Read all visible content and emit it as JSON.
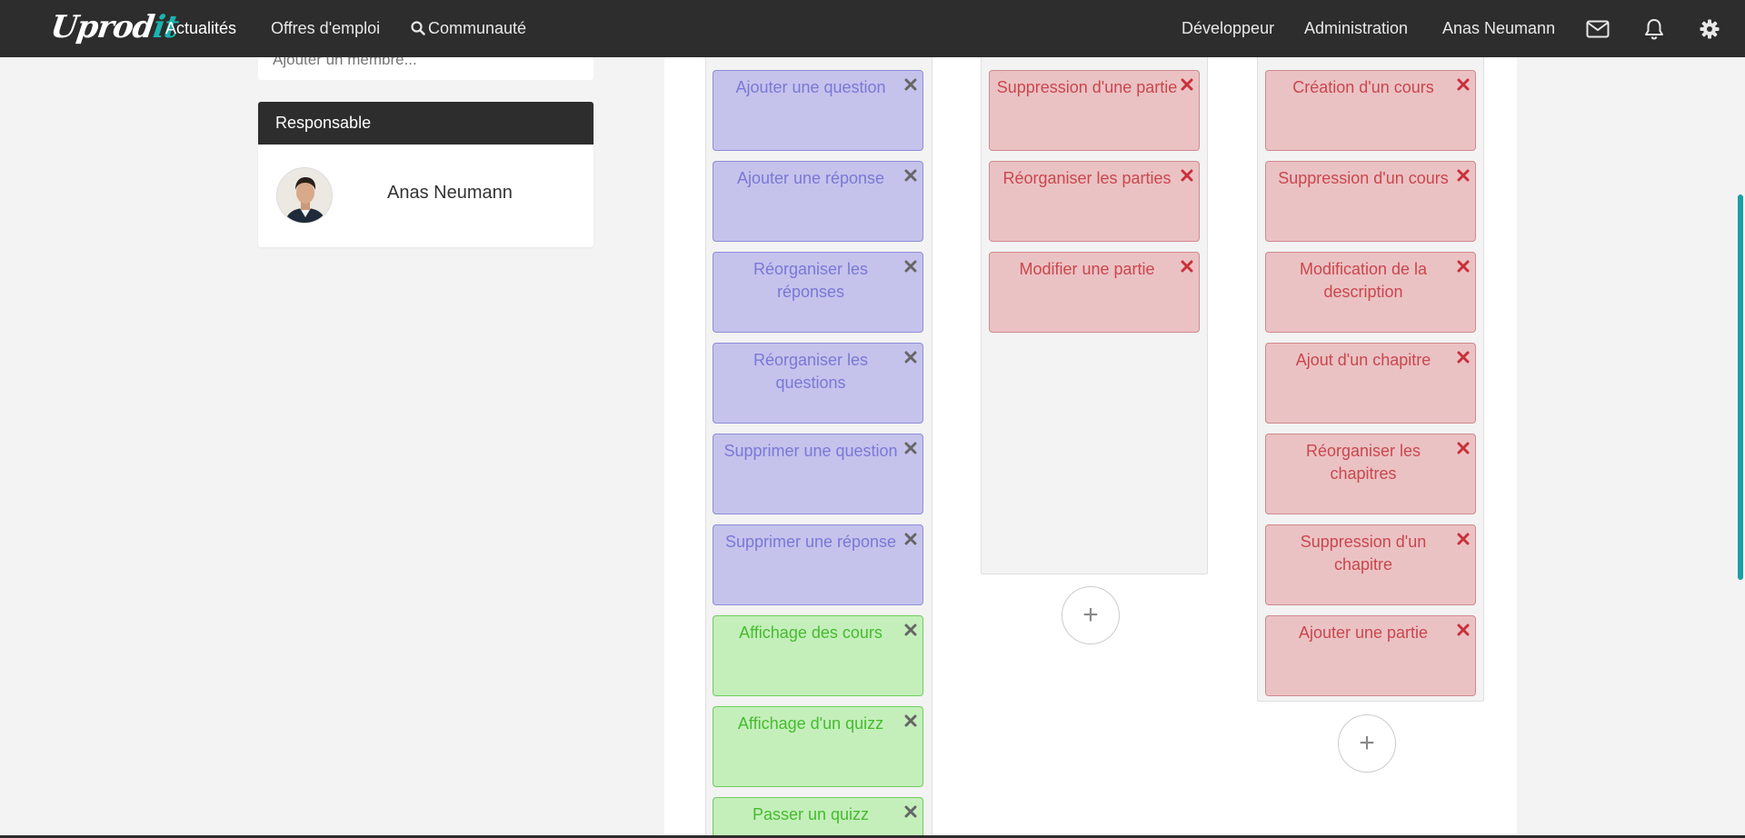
{
  "navbar": {
    "logo_main": "Uprod",
    "logo_accent": "it",
    "links": [
      "Actualités",
      "Offres d'emploi",
      "Communauté"
    ],
    "right_links": [
      "Développeur",
      "Administration",
      "Anas Neumann"
    ],
    "icons": [
      "mail-icon",
      "bell-icon",
      "gear-icon"
    ]
  },
  "sidebar": {
    "add_member_placeholder": "Ajouter un membre...",
    "responsable_title": "Responsable",
    "responsable_name": "Anas Neumann"
  },
  "columns": {
    "col1": {
      "cards": [
        {
          "label": "Ajouter une question",
          "color": "blue"
        },
        {
          "label": "Ajouter une réponse",
          "color": "blue"
        },
        {
          "label": "Réorganiser les réponses",
          "color": "blue"
        },
        {
          "label": "Réorganiser les questions",
          "color": "blue"
        },
        {
          "label": "Supprimer une question",
          "color": "blue"
        },
        {
          "label": "Supprimer une réponse",
          "color": "blue"
        },
        {
          "label": "Affichage des cours",
          "color": "green"
        },
        {
          "label": "Affichage d'un quizz",
          "color": "green"
        },
        {
          "label": "Passer un quizz",
          "color": "green"
        }
      ]
    },
    "col2": {
      "cards": [
        {
          "label": "Suppression d'une partie",
          "color": "red"
        },
        {
          "label": "Réorganiser les parties",
          "color": "red"
        },
        {
          "label": "Modifier une partie",
          "color": "red"
        }
      ],
      "add_label": "+"
    },
    "col3": {
      "cards": [
        {
          "label": "Création d'un cours",
          "color": "red"
        },
        {
          "label": "Suppression d'un cours",
          "color": "red"
        },
        {
          "label": "Modification de la description",
          "color": "red"
        },
        {
          "label": "Ajout d'un chapitre",
          "color": "red"
        },
        {
          "label": "Réorganiser les chapitres",
          "color": "red"
        },
        {
          "label": "Suppression d'un chapitre",
          "color": "red"
        },
        {
          "label": "Ajouter une partie",
          "color": "red"
        }
      ],
      "add_label": "+"
    }
  },
  "colors": {
    "navbar": "#2d2d2d",
    "accent": "#19b3b0",
    "blue_card": "#c5c3ec",
    "red_card": "#ebc2c4",
    "green_card": "#c4efbb"
  }
}
